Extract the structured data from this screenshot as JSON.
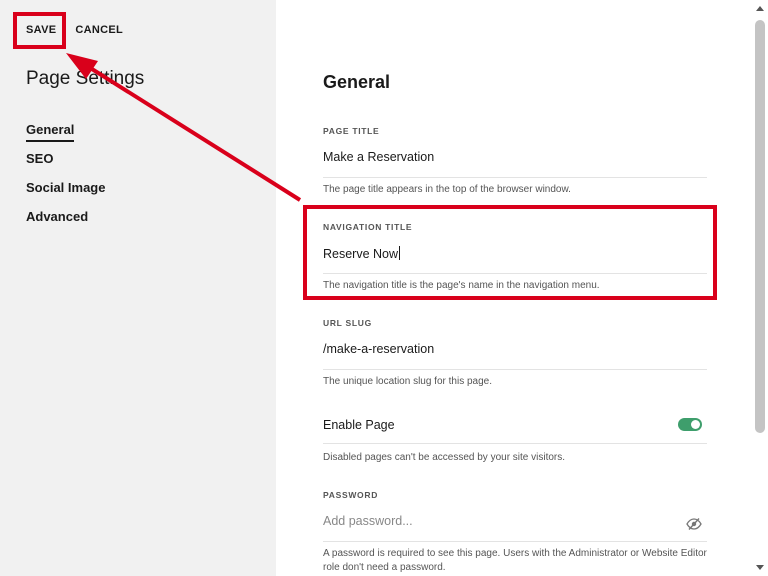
{
  "toolbar": {
    "save_label": "SAVE",
    "cancel_label": "CANCEL"
  },
  "sidebar": {
    "title": "Page Settings",
    "items": [
      {
        "label": "General",
        "active": true
      },
      {
        "label": "SEO",
        "active": false
      },
      {
        "label": "Social Image",
        "active": false
      },
      {
        "label": "Advanced",
        "active": false
      }
    ]
  },
  "main": {
    "section_title": "General",
    "page_title": {
      "label": "PAGE TITLE",
      "value": "Make a Reservation",
      "help": "The page title appears in the top of the browser window."
    },
    "navigation_title": {
      "label": "NAVIGATION TITLE",
      "value": "Reserve Now",
      "help": "The navigation title is the page's name in the navigation menu."
    },
    "url_slug": {
      "label": "URL SLUG",
      "value": "/make-a-reservation",
      "help": "The unique location slug for this page."
    },
    "enable_page": {
      "label": "Enable Page",
      "enabled": true,
      "help": "Disabled pages can't be accessed by your site visitors."
    },
    "password": {
      "label": "PASSWORD",
      "placeholder": "Add password...",
      "help": "A password is required to see this page. Users with the Administrator or Website Editor role don't need a password."
    }
  },
  "colors": {
    "highlight": "#d9001b",
    "toggle_on": "#3e9e6c",
    "sidebar_bg": "#f1f1f1"
  },
  "icons": {
    "password_visibility": "eye-slash-icon"
  }
}
